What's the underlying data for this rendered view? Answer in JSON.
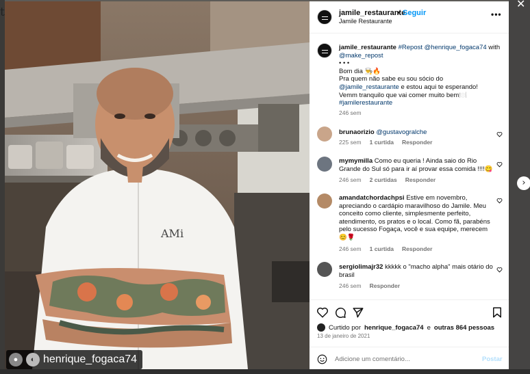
{
  "viewer": {
    "close_glyph": "✕",
    "next_glyph": "›",
    "edge_letter": "t"
  },
  "photo": {
    "alt_subject": "chef in white jacket with tattooed arms in a restaurant kitchen",
    "chef_jacket_logo": "AMi",
    "repost_user": "henrique_fogaca74"
  },
  "header": {
    "username": "jamile_restaurante",
    "separator": "•",
    "follow_label": "Seguir",
    "subtitle": "Jamile Restaurante",
    "more_glyph": "•••"
  },
  "caption": {
    "username": "jamile_restaurante",
    "repost": "#Repost",
    "mention_1": "@henrique_fogaca74",
    "with": "with",
    "mention_2": "@make_repost",
    "dots": "• • •",
    "line_1": "Bom dia 👨‍🍳🔥",
    "line_2a": "Pra quem não sabe eu sou sócio do",
    "line_2_mention": "@jamile_restaurante",
    "line_2b": "e estou aqui te esperando!",
    "line_3": "Vemm tranquilo que vai comer muito bem🍽️",
    "hashtag": "#jamilerestaurante",
    "time": "246 sem"
  },
  "comments": [
    {
      "user": "brunaorizio",
      "text": "@gustavogralche",
      "time": "225 sem",
      "likes": "1 curtida",
      "reply": "Responder"
    },
    {
      "user": "mymymilla",
      "text": "Como eu queria ! Ainda saio do Rio Grande do Sul só para ir aí provar essa comida !!!!😋",
      "time": "246 sem",
      "likes": "2 curtidas",
      "reply": "Responder"
    },
    {
      "user": "amandatchordachpsi",
      "text": "Estive em novembro, apreciando o cardápio maravilhoso do Jamile. Meu conceito como cliente, simplesmente perfeito, atendimento, os pratos e o local. Como fã, parabéns pelo sucesso Fogaça, você e sua equipe, merecem 😊🌹",
      "time": "246 sem",
      "likes": "1 curtida",
      "reply": "Responder"
    },
    {
      "user": "sergiolimajr32",
      "text": "kkkkk o \"macho alpha\" mais otário do brasil",
      "time": "246 sem",
      "likes": "",
      "reply": "Responder"
    }
  ],
  "likes": {
    "prefix": "Curtido por",
    "user": "henrique_fogaca74",
    "and": "e",
    "others": "outras 864 pessoas"
  },
  "date": "13 de janeiro de 2021",
  "add_comment": {
    "placeholder": "Adicione um comentário...",
    "post_label": "Postar"
  },
  "colors": {
    "accent": "#0095f6",
    "link": "#00376b",
    "muted": "#737373"
  }
}
